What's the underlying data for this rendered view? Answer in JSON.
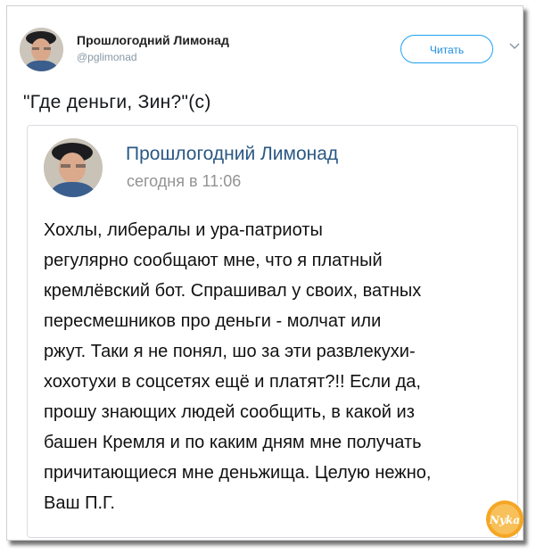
{
  "tweet": {
    "author_name": "Прошлогодний Лимонад",
    "author_handle": "@pglimonad",
    "follow_label": "Читать",
    "text": "\"Где деньги, Зин?\"(c)"
  },
  "quoted_post": {
    "author_name": "Прошлогодний Лимонад",
    "date": "сегодня в 11:06",
    "lines": [
      "Хохлы, либералы и ура-патриоты",
      "регулярно сообщают мне, что я платный",
      "кремлёвский бот. Спрашивал у своих, ватных",
      "пересмешников про деньги - молчат или",
      "ржут. Таки я не понял, шо за эти развлекухи-",
      "хохотухи в соцсетях ещё и платят?!! Если да,",
      "прошу знающих людей сообщить, в какой из",
      "башен Кремля и по каким дням мне получать",
      "причитающиеся мне деньжища. Целую нежно,",
      "Ваш П.Г."
    ]
  },
  "watermark": {
    "text": "Nyka"
  },
  "colors": {
    "follow_blue": "#1da1f2",
    "vk_name_blue": "#2a5885",
    "date_gray": "#939393",
    "handle_gray": "#8899a6"
  },
  "icons": {
    "chevron": "chevron-down-icon"
  }
}
